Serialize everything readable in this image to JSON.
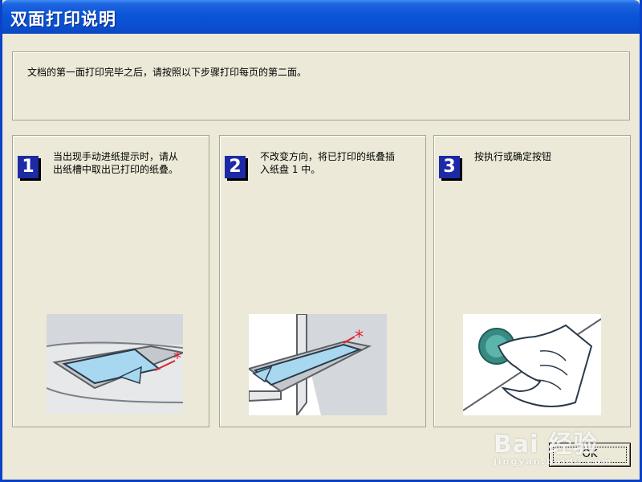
{
  "window": {
    "title": "双面打印说明"
  },
  "intro": {
    "text": "文档的第一面打印完毕之后，请按照以下步骤打印每页的第二面。"
  },
  "steps": [
    {
      "number": "1",
      "lines": [
        "当出现手动进纸提示时，请从",
        "出纸槽中取出已打印的纸叠。"
      ]
    },
    {
      "number": "2",
      "lines": [
        "不改变方向，将已打印的纸叠插",
        "入纸盘 1 中。"
      ]
    },
    {
      "number": "3",
      "lines": [
        "按执行或确定按钮"
      ]
    }
  ],
  "buttons": {
    "ok_label": "OK"
  },
  "watermark": {
    "main": "Bai 经验",
    "sub": "jingyan.baidu.com"
  },
  "colors": {
    "titlebar": "#0a55d8",
    "window_bg": "#ece9d8",
    "step_number_bg": "#1d2aa6",
    "accent_red": "#e0212b",
    "paper_blue": "#a8d8f0"
  },
  "icons": {
    "step1": "paper-output-tray-icon",
    "step2": "paper-input-tray-icon",
    "step3": "press-button-icon"
  }
}
